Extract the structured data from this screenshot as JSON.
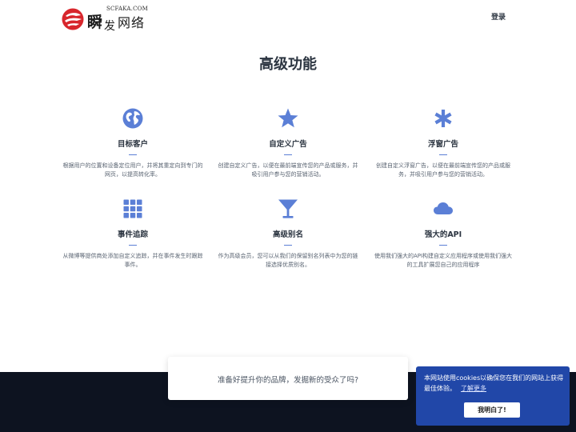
{
  "header": {
    "logo": {
      "domain": "SCFAKA.COM",
      "name_part1": "瞬",
      "name_part2": "发",
      "name_part3": "网络"
    },
    "login_label": "登录"
  },
  "features": {
    "title": "高级功能",
    "items": [
      {
        "icon": "globe-icon",
        "title": "目标客户",
        "description": "根据用户的位置和设备定位用户，并将其重定向到专门的网页，以提高转化率。"
      },
      {
        "icon": "star-icon",
        "title": "自定义广告",
        "description": "创建自定义广告，以便在最前端宣传您的产品或服务，并吸引用户参与您的营销活动。"
      },
      {
        "icon": "asterisk-icon",
        "title": "浮窗广告",
        "description": "创建自定义浮窗广告，以便在最前端宣传您的产品或服务，并吸引用户参与您的营销活动。"
      },
      {
        "icon": "grid-icon",
        "title": "事件追踪",
        "description": "从微博等提供商处添加自定义追踪，并在事件发生时跟踪事件。"
      },
      {
        "icon": "cocktail-icon",
        "title": "高级别名",
        "description": "作为高级会员，您可以从我们的保留别名列表中为您的链接选择优质别名。"
      },
      {
        "icon": "cloud-icon",
        "title": "强大的API",
        "description": "使用我们强大的API构建自定义应用程序或使用我们强大的工具扩展您自己的应用程序"
      }
    ]
  },
  "cta": {
    "text": "准备好提升你的品牌，发掘新的受众了吗?"
  },
  "cookie": {
    "message": "本网站使用cookies以确保您在我们的网站上获得最佳体验。",
    "learn_more": "了解更多",
    "accept_label": "我明白了!"
  },
  "colors": {
    "accent": "#5b7fd6",
    "footer_bg": "#0d1320",
    "cookie_bg": "#2147a8",
    "logo_red": "#d8262c"
  }
}
